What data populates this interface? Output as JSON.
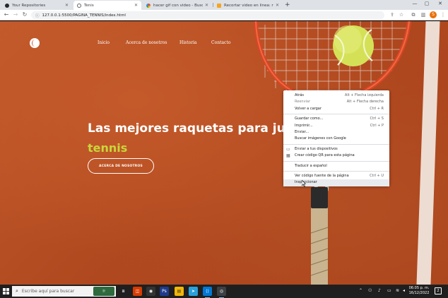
{
  "browser": {
    "tabs": [
      {
        "title": "Your Repositories",
        "active": false
      },
      {
        "title": "Tenis",
        "active": true
      },
      {
        "title": "hacer gif con video - Buscar con Google",
        "active": false
      },
      {
        "title": "Recortar video en línea: recorte videos",
        "active": false
      }
    ],
    "new_tab": "+",
    "url": "127.0.0.1:5500/PAGINA_TENNIS/index.html",
    "avatar_letter": "S"
  },
  "page": {
    "nav": [
      "Inicio",
      "Acerca de nosotros",
      "Historia",
      "Contacto"
    ],
    "hero_title": "Las mejores raquetas para jug",
    "hero_accent": "tennis",
    "hero_button": "ACERCA DE NOSOTROS",
    "colors": {
      "clay": "#c15a2c",
      "accent": "#c9d63a",
      "ball": "#d4e157"
    }
  },
  "context_menu": {
    "groups": [
      [
        {
          "label": "Atrás",
          "shortcut": "Alt + Flecha izquierda"
        },
        {
          "label": "Reenviar",
          "shortcut": "Alt + Flecha derecha",
          "disabled": true
        },
        {
          "label": "Volver a cargar",
          "shortcut": "Ctrl + R"
        }
      ],
      [
        {
          "label": "Guardar como...",
          "shortcut": "Ctrl + S"
        },
        {
          "label": "Imprimir...",
          "shortcut": "Ctrl + P"
        },
        {
          "label": "Enviar...",
          "shortcut": ""
        },
        {
          "label": "Buscar imágenes con Google",
          "shortcut": ""
        }
      ],
      [
        {
          "label": "Enviar a tus dispositivos",
          "shortcut": "",
          "icon": "devices-icon"
        },
        {
          "label": "Crear código QR para esta página",
          "shortcut": "",
          "icon": "qr-code-icon"
        }
      ],
      [
        {
          "label": "Traducir a español",
          "shortcut": ""
        }
      ],
      [
        {
          "label": "Ver código fuente de la página",
          "shortcut": "Ctrl + U"
        },
        {
          "label": "Inspeccionar",
          "shortcut": "",
          "hover": true
        }
      ]
    ]
  },
  "taskbar": {
    "search_placeholder": "Escribe aquí para buscar",
    "time": "06:05 p. m.",
    "date": "16/12/2022",
    "notifications": "2"
  }
}
